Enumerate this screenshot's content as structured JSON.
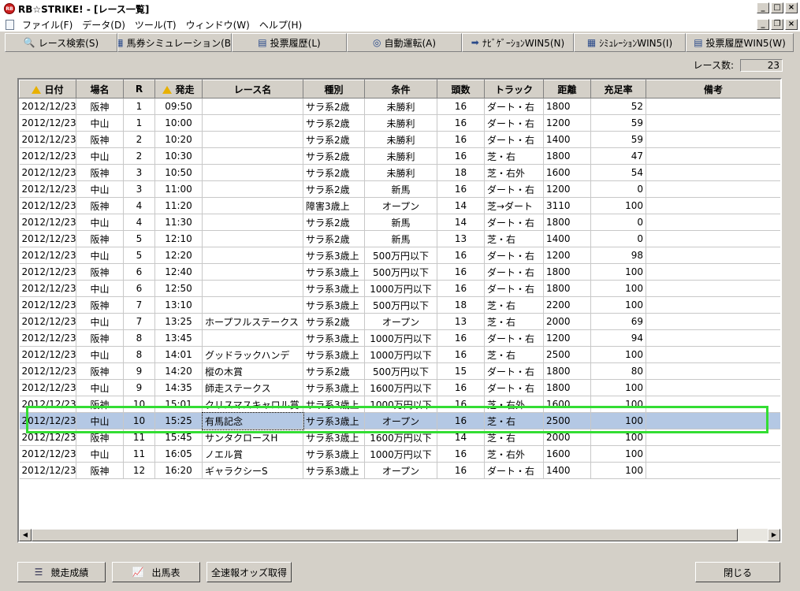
{
  "window": {
    "title": "RB☆STRIKE! - [レース一覧]",
    "app_icon_text": "RB"
  },
  "menu": [
    "ファイル(F)",
    "データ(D)",
    "ツール(T)",
    "ウィンドウ(W)",
    "ヘルプ(H)"
  ],
  "toolbar": [
    {
      "label": "レース検索(S)",
      "icon": "🔍"
    },
    {
      "label": "馬券シミュレーション(B)",
      "icon": "▦"
    },
    {
      "label": "投票履歴(L)",
      "icon": "▤"
    },
    {
      "label": "自動運転(A)",
      "icon": "◎"
    },
    {
      "label": "ﾅﾋﾞｹﾞｰｼｮﾝWIN5(N)",
      "icon": "➡"
    },
    {
      "label": "ｼﾐｭﾚｰｼｮﾝWIN5(I)",
      "icon": "▦"
    },
    {
      "label": "投票履歴WIN5(W)",
      "icon": "▤"
    }
  ],
  "race_count": {
    "label": "レース数:",
    "value": "23"
  },
  "columns": [
    "日付",
    "場名",
    "R",
    "発走",
    "レース名",
    "種別",
    "条件",
    "頭数",
    "トラック",
    "距離",
    "充足率",
    "備考"
  ],
  "rows": [
    [
      "2012/12/23",
      "阪神",
      "1",
      "09:50",
      "",
      "サラ系2歳",
      "未勝利",
      "16",
      "ダート・右",
      "1800",
      "52",
      ""
    ],
    [
      "2012/12/23",
      "中山",
      "1",
      "10:00",
      "",
      "サラ系2歳",
      "未勝利",
      "16",
      "ダート・右",
      "1200",
      "59",
      ""
    ],
    [
      "2012/12/23",
      "阪神",
      "2",
      "10:20",
      "",
      "サラ系2歳",
      "未勝利",
      "16",
      "ダート・右",
      "1400",
      "59",
      ""
    ],
    [
      "2012/12/23",
      "中山",
      "2",
      "10:30",
      "",
      "サラ系2歳",
      "未勝利",
      "16",
      "芝・右",
      "1800",
      "47",
      ""
    ],
    [
      "2012/12/23",
      "阪神",
      "3",
      "10:50",
      "",
      "サラ系2歳",
      "未勝利",
      "18",
      "芝・右外",
      "1600",
      "54",
      ""
    ],
    [
      "2012/12/23",
      "中山",
      "3",
      "11:00",
      "",
      "サラ系2歳",
      "新馬",
      "16",
      "ダート・右",
      "1200",
      "0",
      ""
    ],
    [
      "2012/12/23",
      "阪神",
      "4",
      "11:20",
      "",
      "障害3歳上",
      "オープン",
      "14",
      "芝→ダート",
      "3110",
      "100",
      ""
    ],
    [
      "2012/12/23",
      "中山",
      "4",
      "11:30",
      "",
      "サラ系2歳",
      "新馬",
      "14",
      "ダート・右",
      "1800",
      "0",
      ""
    ],
    [
      "2012/12/23",
      "阪神",
      "5",
      "12:10",
      "",
      "サラ系2歳",
      "新馬",
      "13",
      "芝・右",
      "1400",
      "0",
      ""
    ],
    [
      "2012/12/23",
      "中山",
      "5",
      "12:20",
      "",
      "サラ系3歳上",
      "500万円以下",
      "16",
      "ダート・右",
      "1200",
      "98",
      ""
    ],
    [
      "2012/12/23",
      "阪神",
      "6",
      "12:40",
      "",
      "サラ系3歳上",
      "500万円以下",
      "16",
      "ダート・右",
      "1800",
      "100",
      ""
    ],
    [
      "2012/12/23",
      "中山",
      "6",
      "12:50",
      "",
      "サラ系3歳上",
      "1000万円以下",
      "16",
      "ダート・右",
      "1800",
      "100",
      ""
    ],
    [
      "2012/12/23",
      "阪神",
      "7",
      "13:10",
      "",
      "サラ系3歳上",
      "500万円以下",
      "18",
      "芝・右",
      "2200",
      "100",
      ""
    ],
    [
      "2012/12/23",
      "中山",
      "7",
      "13:25",
      "ホープフルステークス",
      "サラ系2歳",
      "オープン",
      "13",
      "芝・右",
      "2000",
      "69",
      ""
    ],
    [
      "2012/12/23",
      "阪神",
      "8",
      "13:45",
      "",
      "サラ系3歳上",
      "1000万円以下",
      "16",
      "ダート・右",
      "1200",
      "94",
      ""
    ],
    [
      "2012/12/23",
      "中山",
      "8",
      "14:01",
      "グッドラックハンデ",
      "サラ系3歳上",
      "1000万円以下",
      "16",
      "芝・右",
      "2500",
      "100",
      ""
    ],
    [
      "2012/12/23",
      "阪神",
      "9",
      "14:20",
      "樅の木賞",
      "サラ系2歳",
      "500万円以下",
      "15",
      "ダート・右",
      "1800",
      "80",
      ""
    ],
    [
      "2012/12/23",
      "中山",
      "9",
      "14:35",
      "師走ステークス",
      "サラ系3歳上",
      "1600万円以下",
      "16",
      "ダート・右",
      "1800",
      "100",
      ""
    ],
    [
      "2012/12/23",
      "阪神",
      "10",
      "15:01",
      "クリスマスキャロル賞",
      "サラ系3歳上",
      "1000万円以下",
      "16",
      "芝・右外",
      "1600",
      "100",
      ""
    ],
    [
      "2012/12/23",
      "中山",
      "10",
      "15:25",
      "有馬記念",
      "サラ系3歳上",
      "オープン",
      "16",
      "芝・右",
      "2500",
      "100",
      ""
    ],
    [
      "2012/12/23",
      "阪神",
      "11",
      "15:45",
      "サンタクロースH",
      "サラ系3歳上",
      "1600万円以下",
      "14",
      "芝・右",
      "2000",
      "100",
      ""
    ],
    [
      "2012/12/23",
      "中山",
      "11",
      "16:05",
      "ノエル賞",
      "サラ系3歳上",
      "1000万円以下",
      "16",
      "芝・右外",
      "1600",
      "100",
      ""
    ],
    [
      "2012/12/23",
      "阪神",
      "12",
      "16:20",
      "ギャラクシーS",
      "サラ系3歳上",
      "オープン",
      "16",
      "ダート・右",
      "1400",
      "100",
      ""
    ]
  ],
  "selected_row": 19,
  "buttons": {
    "results": "競走成績",
    "entries": "出馬表",
    "odds": "全速報オッズ取得",
    "close": "閉じる"
  },
  "colors": {
    "selection": "#b4c8e4",
    "highlight_box": "#33dd33",
    "chrome": "#d4d0c8"
  }
}
